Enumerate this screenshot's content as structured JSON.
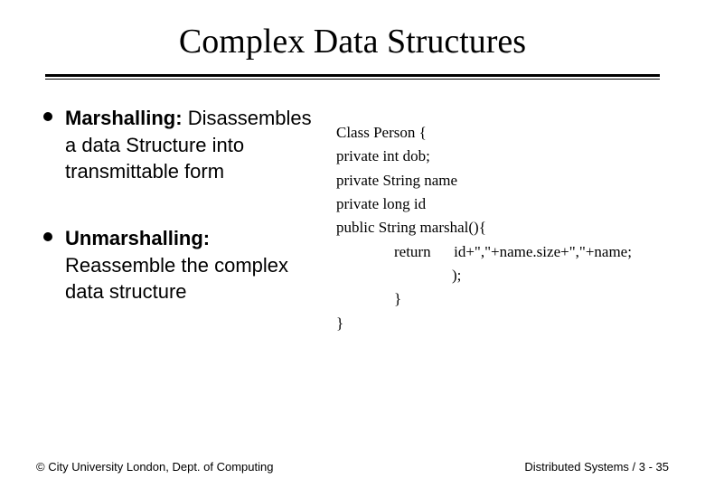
{
  "title": "Complex Data Structures",
  "left": {
    "items": [
      {
        "term": "Marshalling:",
        "desc": "Disassembles a data Structure into transmittable form"
      },
      {
        "term": "Unmarshalling:",
        "desc": "Reassemble the complex data structure"
      }
    ]
  },
  "code": {
    "l0": "Class Person {",
    "l1": "private int dob;",
    "l2": "private String name",
    "l3": "private long id",
    "l4": "public String marshal(){",
    "l5_a": "return",
    "l5_b": "id+\",\"+name.size+\",\"+name;",
    "l6": ");",
    "l7": "}",
    "l8": "}"
  },
  "footer": {
    "left": "© City University London, Dept. of Computing",
    "right": "Distributed Systems / 3 - 35"
  }
}
